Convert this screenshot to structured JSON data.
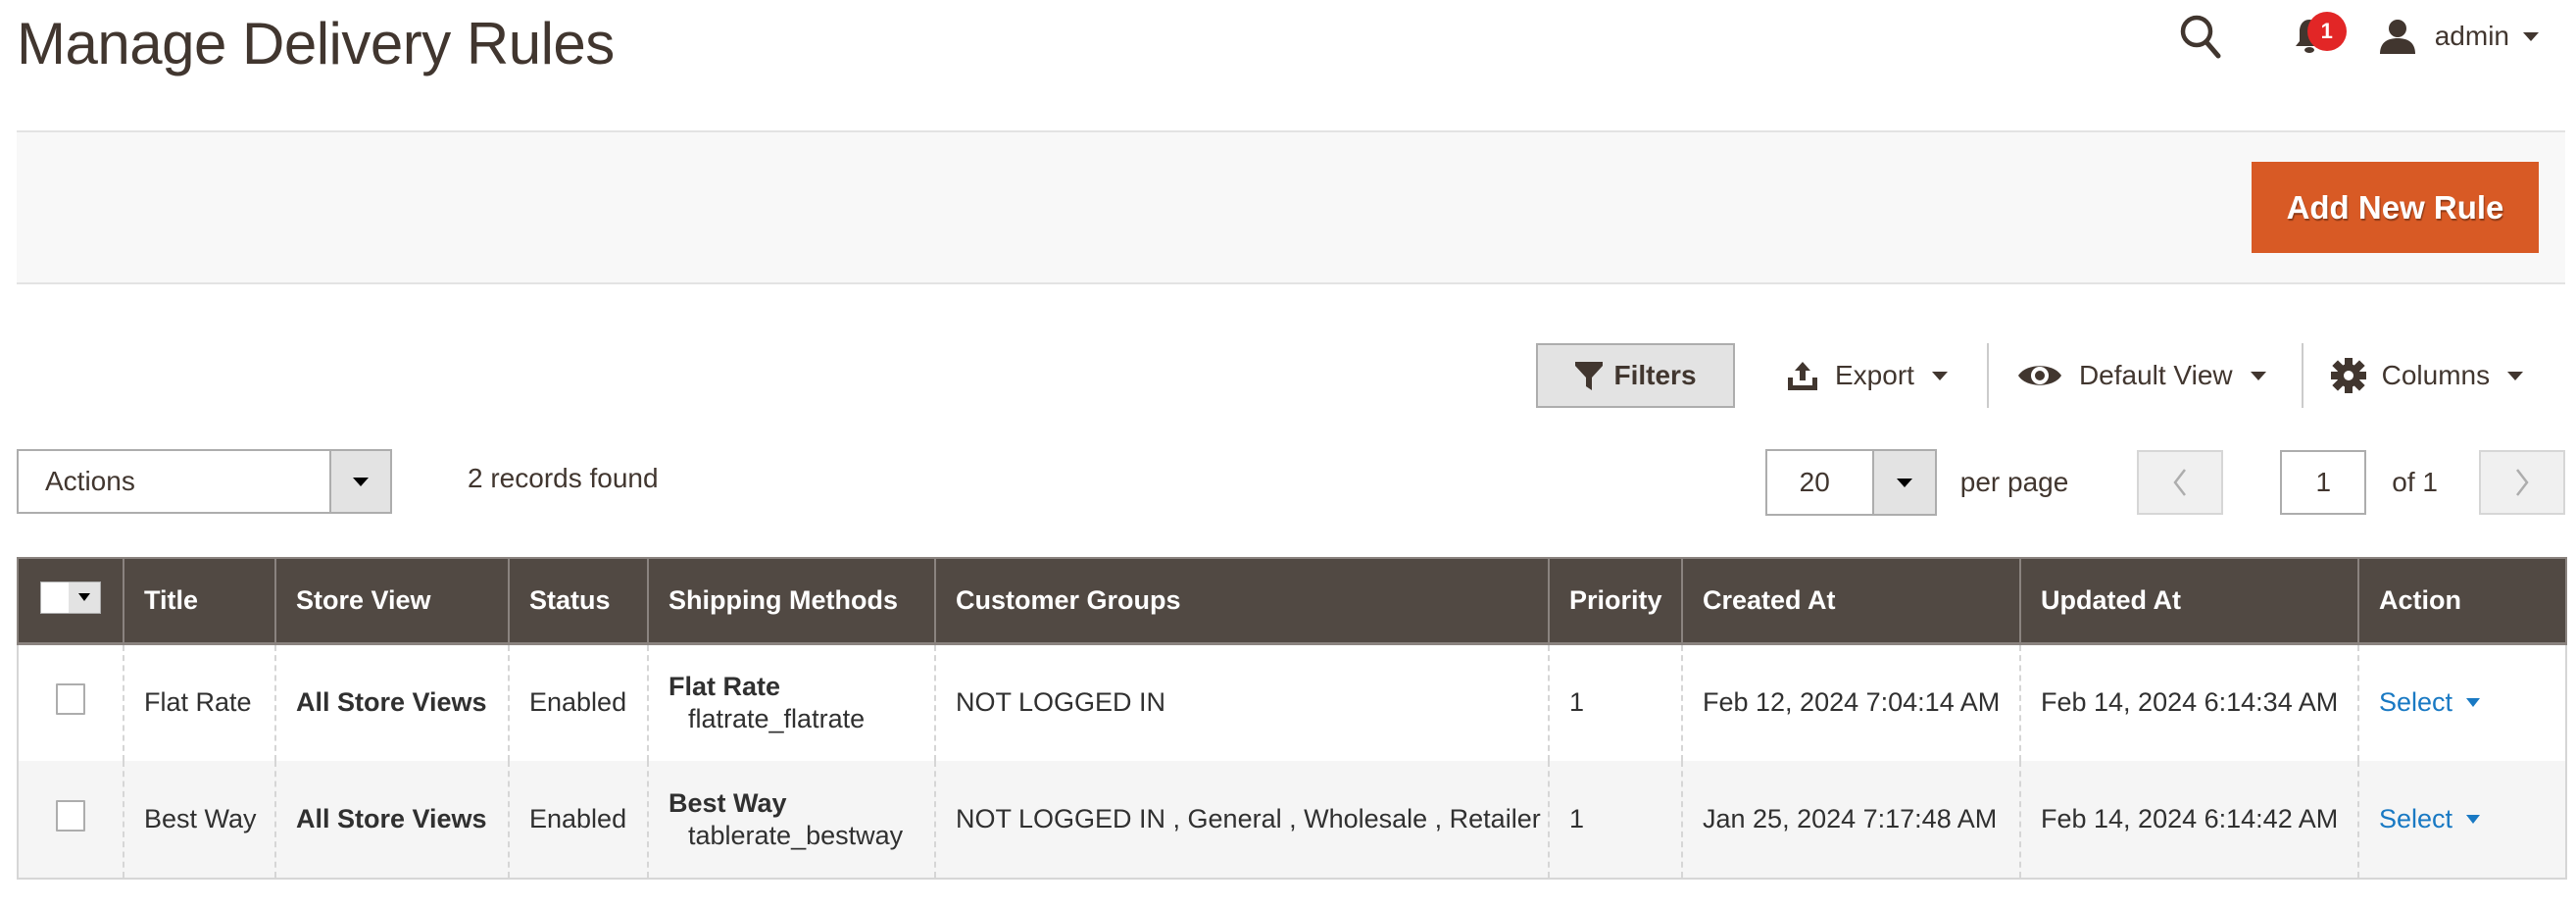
{
  "page": {
    "title": "Manage Delivery Rules"
  },
  "header": {
    "search_icon": "search-icon",
    "notifications_icon": "bell-icon",
    "notifications_count": "1",
    "user_icon": "user-icon",
    "user_name": "admin"
  },
  "page_actions": {
    "add_button_label": "Add New Rule",
    "accent_color": "#d85a25"
  },
  "toolbar": {
    "filters_label": "Filters",
    "export_label": "Export",
    "view_label": "Default View",
    "columns_label": "Columns"
  },
  "grid_controls": {
    "mass_action_value": "Actions",
    "records_found": "2 records found",
    "per_page_value": "20",
    "per_page_label": "per page",
    "current_page": "1",
    "total_pages_label": "of 1"
  },
  "table": {
    "columns": [
      "Title",
      "Store View",
      "Status",
      "Shipping Methods",
      "Customer Groups",
      "Priority",
      "Created At",
      "Updated At",
      "Action"
    ],
    "rows": [
      {
        "title": "Flat Rate",
        "store_view": "All Store Views",
        "status": "Enabled",
        "shipping_method_name": "Flat Rate",
        "shipping_method_code": "flatrate_flatrate",
        "customer_groups": "NOT LOGGED IN",
        "priority": "1",
        "created_at": "Feb 12, 2024 7:04:14 AM",
        "updated_at": "Feb 14, 2024 6:14:34 AM",
        "action_label": "Select"
      },
      {
        "title": "Best Way",
        "store_view": "All Store Views",
        "status": "Enabled",
        "shipping_method_name": "Best Way",
        "shipping_method_code": "tablerate_bestway",
        "customer_groups": "NOT LOGGED IN , General , Wholesale , Retailer",
        "priority": "1",
        "created_at": "Jan 25, 2024 7:17:48 AM",
        "updated_at": "Feb 14, 2024 6:14:42 AM",
        "action_label": "Select"
      }
    ]
  }
}
